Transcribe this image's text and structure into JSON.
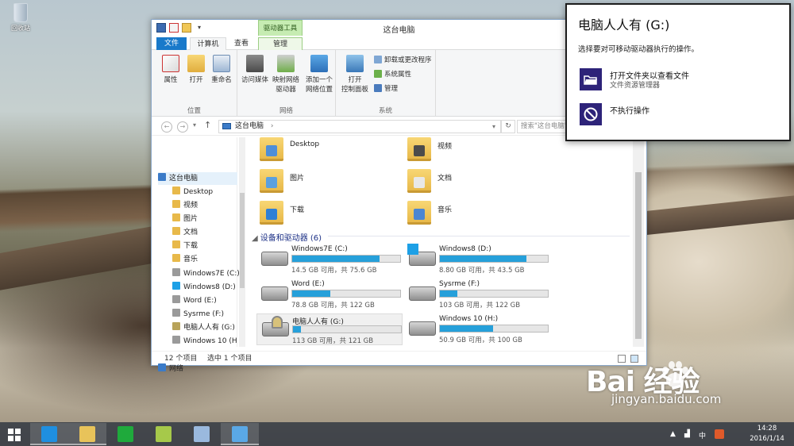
{
  "desktop": {
    "recycle_bin_label": "回收站"
  },
  "explorer": {
    "title": "这台电脑",
    "context_tab": "驱动器工具",
    "tabs": [
      "文件",
      "计算机",
      "查看",
      "管理"
    ],
    "ribbon": {
      "location": {
        "label": "位置",
        "buttons": [
          "属性",
          "打开",
          "重命名"
        ]
      },
      "network": {
        "label": "网络",
        "buttons": [
          "访问媒体",
          "映射网络\n驱动器",
          "添加一个\n网络位置"
        ]
      },
      "system": {
        "label": "系统",
        "buttons": [
          "打开\n控制面板"
        ],
        "small": [
          "卸载或更改程序",
          "系统属性",
          "管理"
        ]
      }
    },
    "address": {
      "path": "这台电脑",
      "search_placeholder": "搜索\"这台电脑\""
    },
    "nav": [
      {
        "label": "这台电脑",
        "level": 0,
        "selected": true,
        "icon": "computer-icon",
        "color": "#3b7bc8"
      },
      {
        "label": "Desktop",
        "level": 1,
        "icon": "folder-icon",
        "color": "#e8b94a"
      },
      {
        "label": "视频",
        "level": 1,
        "icon": "folder-icon",
        "color": "#e8b94a"
      },
      {
        "label": "图片",
        "level": 1,
        "icon": "folder-icon",
        "color": "#e8b94a"
      },
      {
        "label": "文档",
        "level": 1,
        "icon": "folder-icon",
        "color": "#e8b94a"
      },
      {
        "label": "下载",
        "level": 1,
        "icon": "folder-icon",
        "color": "#e8b94a"
      },
      {
        "label": "音乐",
        "level": 1,
        "icon": "folder-icon",
        "color": "#e8b94a"
      },
      {
        "label": "Windows7E (C:)",
        "level": 1,
        "icon": "drive-icon",
        "color": "#9a9a9a"
      },
      {
        "label": "Windows8 (D:)",
        "level": 1,
        "icon": "drive-icon",
        "color": "#1da0e6"
      },
      {
        "label": "Word (E:)",
        "level": 1,
        "icon": "drive-icon",
        "color": "#9a9a9a"
      },
      {
        "label": "Sysrme (F:)",
        "level": 1,
        "icon": "drive-icon",
        "color": "#9a9a9a"
      },
      {
        "label": "电脑人人有 (G:)",
        "level": 1,
        "icon": "drive-icon",
        "color": "#b8a35a"
      },
      {
        "label": "Windows 10 (H",
        "level": 1,
        "icon": "drive-icon",
        "color": "#9a9a9a"
      },
      {
        "label": "网络",
        "level": 0,
        "icon": "network-icon",
        "color": "#3b7bc8"
      }
    ],
    "folders": [
      {
        "label": "Desktop",
        "badge": "#4e8ed8"
      },
      {
        "label": "视频",
        "badge": "#4b4b4b"
      },
      {
        "label": "图片",
        "badge": "#5aa0e0"
      },
      {
        "label": "文档",
        "badge": "#e8e8e8"
      },
      {
        "label": "下载",
        "badge": "#2f7fd6"
      },
      {
        "label": "音乐",
        "badge": "#4b86d2"
      }
    ],
    "devices_header": "设备和驱动器 (6)",
    "drives": [
      {
        "name": "Windows7E (C:)",
        "free": "14.5 GB 可用，共 75.6 GB",
        "used": 0.81,
        "kind": "hdd"
      },
      {
        "name": "Windows8 (D:)",
        "free": "8.80 GB 可用，共 43.5 GB",
        "used": 0.8,
        "kind": "win"
      },
      {
        "name": "Word (E:)",
        "free": "78.8 GB 可用，共 122 GB",
        "used": 0.35,
        "kind": "hdd"
      },
      {
        "name": "Sysrme (F:)",
        "free": "103 GB 可用，共 122 GB",
        "used": 0.16,
        "kind": "hdd"
      },
      {
        "name": "电脑人人有 (G:)",
        "free": "113 GB 可用，共 121 GB",
        "used": 0.07,
        "kind": "lock",
        "selected": true
      },
      {
        "name": "Windows 10 (H:)",
        "free": "50.9 GB 可用，共 100 GB",
        "used": 0.49,
        "kind": "hdd"
      }
    ],
    "status": {
      "count": "12 个项目",
      "selection": "选中 1 个项目"
    }
  },
  "autoplay": {
    "title": "电脑人人有 (G:)",
    "subtitle": "选择要对可移动驱动器执行的操作。",
    "options": [
      {
        "label": "打开文件夹以查看文件",
        "sub": "文件资源管理器",
        "icon": "folder-open-icon"
      },
      {
        "label": "不执行操作",
        "sub": "",
        "icon": "no-action-icon"
      }
    ]
  },
  "watermark": {
    "brand": "Bai  经验",
    "url": "jingyan.baidu.com"
  },
  "taskbar": {
    "apps": [
      {
        "name": "ie-icon",
        "color": "#1f8fe0",
        "open": true
      },
      {
        "name": "file-explorer-icon",
        "color": "#e8c35a",
        "open": true
      },
      {
        "name": "store-icon",
        "color": "#1faa3c",
        "open": false
      },
      {
        "name": "photos-icon",
        "color": "#a6c94a",
        "open": false
      },
      {
        "name": "paint-icon",
        "color": "#9ab9de",
        "open": false
      },
      {
        "name": "remote-icon",
        "color": "#5aa8e6",
        "open": true
      }
    ],
    "time": "14:28",
    "date": "2016/1/14",
    "ime": "中"
  }
}
